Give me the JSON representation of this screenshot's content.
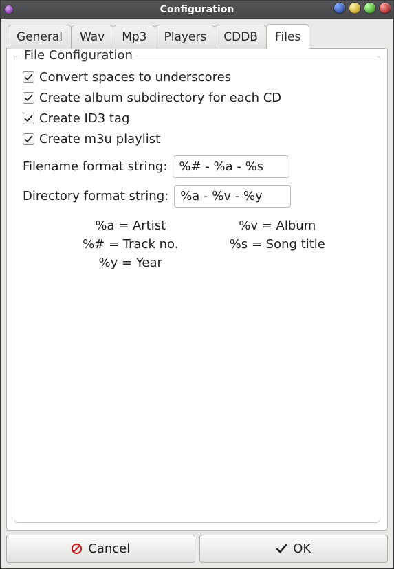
{
  "window": {
    "title": "Configuration"
  },
  "tabs": {
    "general": "General",
    "wav": "Wav",
    "mp3": "Mp3",
    "players": "Players",
    "cddb": "CDDB",
    "files": "Files",
    "active": "files"
  },
  "group": {
    "legend": "File Configuration",
    "opt_spaces": "Convert spaces to underscores",
    "opt_subdir": "Create album subdirectory for each CD",
    "opt_id3": "Create ID3 tag",
    "opt_m3u": "Create m3u playlist",
    "checked": {
      "spaces": true,
      "subdir": true,
      "id3": true,
      "m3u": true
    },
    "filename_label": "Filename format string:",
    "filename_value": "%# - %a - %s",
    "directory_label": "Directory format string:",
    "directory_value": "%a - %v - %y",
    "hints": {
      "artist": "%a = Artist",
      "album": "%v = Album",
      "track": "%# = Track no.",
      "song": "%s = Song title",
      "year": "%y = Year"
    }
  },
  "buttons": {
    "cancel": "Cancel",
    "ok": "OK"
  }
}
